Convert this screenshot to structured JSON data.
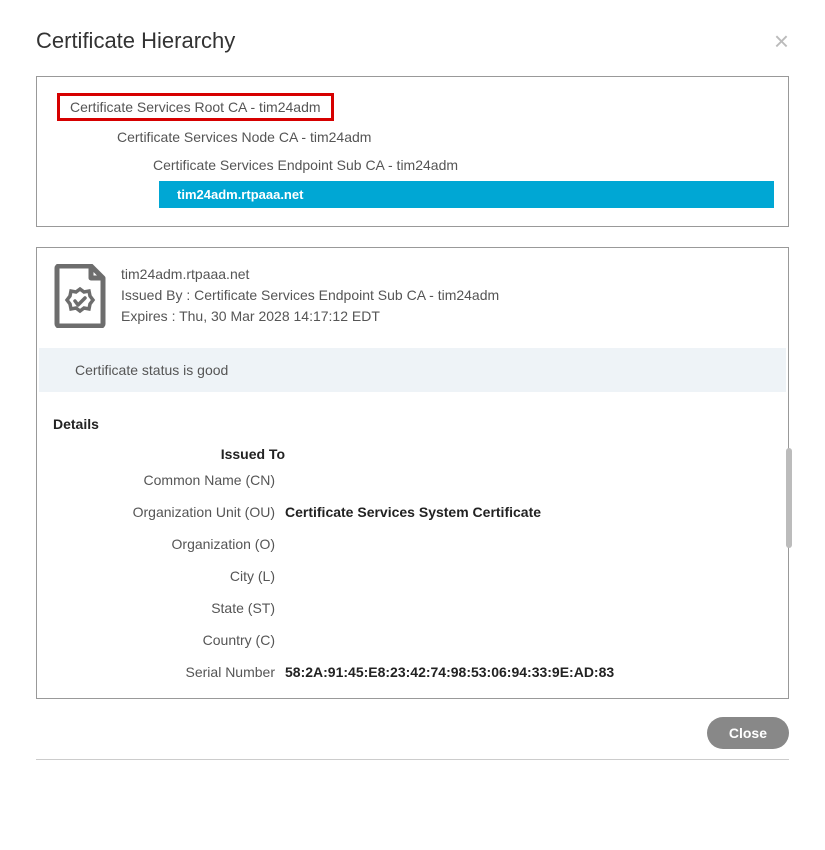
{
  "title": "Certificate Hierarchy",
  "hierarchy": {
    "level0": "Certificate Services Root CA - tim24adm",
    "level1": "Certificate Services Node CA - tim24adm",
    "level2": "Certificate Services Endpoint Sub CA - tim24adm",
    "level3": "tim24adm.rtpaaa.net"
  },
  "summary": {
    "cn": "tim24adm.rtpaaa.net",
    "issued_by": "Issued By : Certificate Services Endpoint Sub CA - tim24adm",
    "expires": "Expires : Thu, 30 Mar 2028 14:17:12 EDT"
  },
  "status": "Certificate status is good",
  "details_heading": "Details",
  "issued_to_heading": "Issued To",
  "fields": {
    "cn_label": "Common Name (CN)",
    "cn_value": "",
    "ou_label": "Organization Unit (OU)",
    "ou_value": "Certificate Services System Certificate",
    "o_label": "Organization (O)",
    "o_value": "",
    "l_label": "City (L)",
    "l_value": "",
    "st_label": "State (ST)",
    "st_value": "",
    "c_label": "Country (C)",
    "c_value": "",
    "serial_label": "Serial Number",
    "serial_value": "58:2A:91:45:E8:23:42:74:98:53:06:94:33:9E:AD:83"
  },
  "close_label": "Close"
}
